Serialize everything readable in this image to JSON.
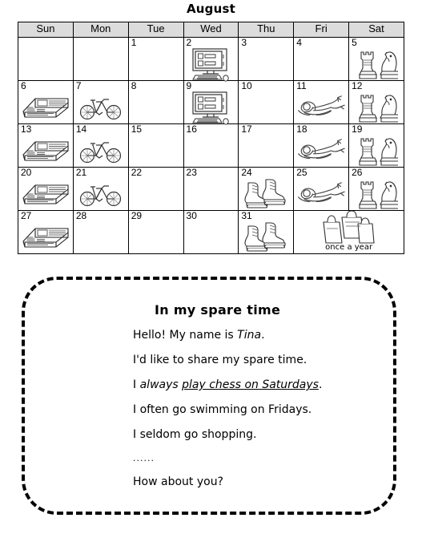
{
  "calendar": {
    "title": "August",
    "weekday_headers": [
      "Sun",
      "Mon",
      "Tue",
      "Wed",
      "Thu",
      "Fri",
      "Sat"
    ],
    "annual_label": "once a year",
    "annual_icon": "shopping-bags-icon",
    "weeks": [
      [
        {
          "day": "",
          "icon": ""
        },
        {
          "day": "",
          "icon": ""
        },
        {
          "day": "1",
          "icon": ""
        },
        {
          "day": "2",
          "icon": "computer-icon"
        },
        {
          "day": "3",
          "icon": ""
        },
        {
          "day": "4",
          "icon": ""
        },
        {
          "day": "5",
          "icon": "chess-icon"
        }
      ],
      [
        {
          "day": "6",
          "icon": "newspaper-icon"
        },
        {
          "day": "7",
          "icon": "bicycle-icon"
        },
        {
          "day": "8",
          "icon": ""
        },
        {
          "day": "9",
          "icon": "computer-icon"
        },
        {
          "day": "10",
          "icon": ""
        },
        {
          "day": "11",
          "icon": "swimmer-icon"
        },
        {
          "day": "12",
          "icon": "chess-icon"
        }
      ],
      [
        {
          "day": "13",
          "icon": "newspaper-icon"
        },
        {
          "day": "14",
          "icon": "bicycle-icon"
        },
        {
          "day": "15",
          "icon": ""
        },
        {
          "day": "16",
          "icon": ""
        },
        {
          "day": "17",
          "icon": ""
        },
        {
          "day": "18",
          "icon": "swimmer-icon"
        },
        {
          "day": "19",
          "icon": "chess-icon"
        }
      ],
      [
        {
          "day": "20",
          "icon": "newspaper-icon"
        },
        {
          "day": "21",
          "icon": "bicycle-icon"
        },
        {
          "day": "22",
          "icon": ""
        },
        {
          "day": "23",
          "icon": ""
        },
        {
          "day": "24",
          "icon": "ice-skates-icon"
        },
        {
          "day": "25",
          "icon": "swimmer-icon"
        },
        {
          "day": "26",
          "icon": "chess-icon"
        }
      ],
      [
        {
          "day": "27",
          "icon": "newspaper-icon"
        },
        {
          "day": "28",
          "icon": ""
        },
        {
          "day": "29",
          "icon": ""
        },
        {
          "day": "30",
          "icon": ""
        },
        {
          "day": "31",
          "icon": "ice-skates-icon"
        }
      ]
    ]
  },
  "panel": {
    "heading": "In my spare time",
    "lines": [
      {
        "id": "greeting",
        "pre": "Hello! My name is ",
        "italic": "Tina",
        "post": "."
      },
      {
        "id": "intro",
        "pre": "I'd like to share my spare time.",
        "italic": "",
        "post": ""
      },
      {
        "id": "always",
        "pre": "I ",
        "italic_plain": "always ",
        "underlined": "play chess on Saturdays",
        "post": "."
      },
      {
        "id": "often",
        "pre": "I often go swimming on Fridays.",
        "italic": "",
        "post": ""
      },
      {
        "id": "seldom",
        "pre": "I seldom go shopping.",
        "italic": "",
        "post": ""
      },
      {
        "id": "ellipsis",
        "pre": "......",
        "italic": "",
        "post": ""
      },
      {
        "id": "question",
        "pre": "How about you?",
        "italic": "",
        "post": ""
      }
    ]
  },
  "colors": {
    "header_bg": "#dcdcdc",
    "border": "#000000",
    "text": "#000000",
    "page_bg": "#ffffff"
  }
}
